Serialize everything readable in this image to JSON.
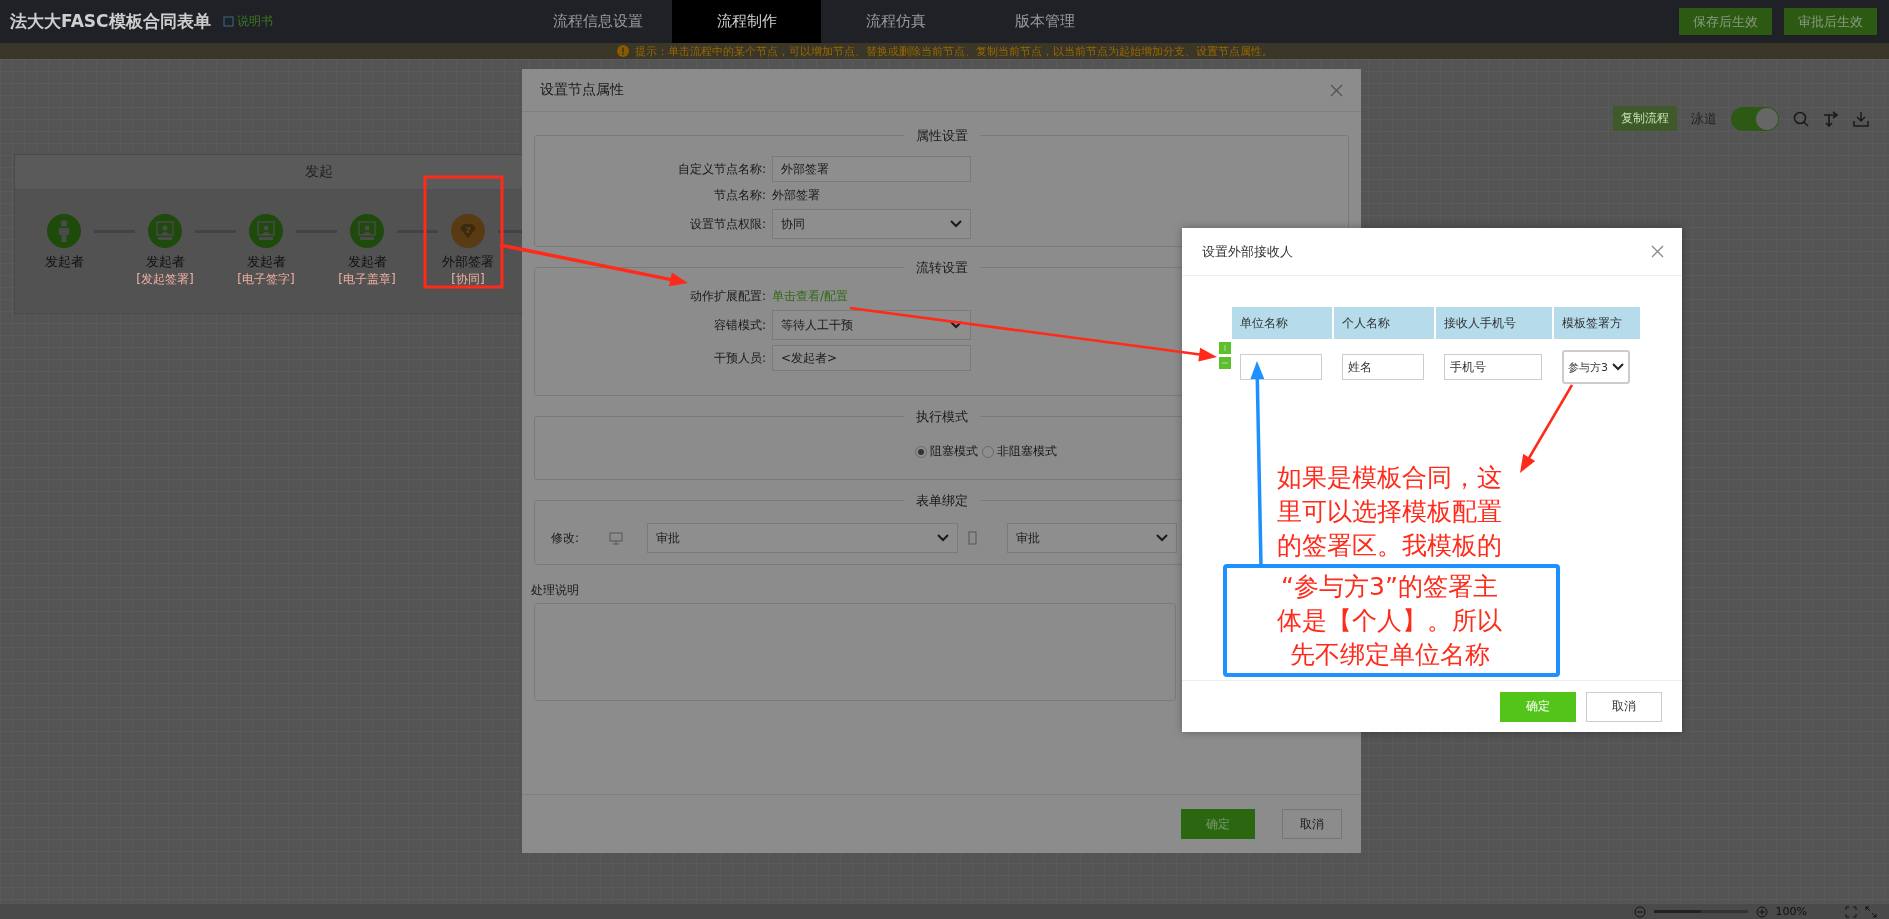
{
  "app": {
    "title": "法大大FASC模板合同表单",
    "manual_link": "说明书"
  },
  "nav_tabs": [
    {
      "label": "流程信息设置",
      "selected": false
    },
    {
      "label": "流程制作",
      "selected": true
    },
    {
      "label": "流程仿真",
      "selected": false
    },
    {
      "label": "版本管理",
      "selected": false
    }
  ],
  "header_buttons": [
    "保存后生效",
    "审批后生效"
  ],
  "hint": "提示：单击流程中的某个节点，可以增加节点、替换或删除当前节点、复制当前节点，以当前节点为起始增加分支、设置节点属性。",
  "toolbar": {
    "copy_button": "复制流程",
    "lane_label": "泳道",
    "lane_on": true
  },
  "lane": {
    "title": "发起",
    "nodes": [
      {
        "kind": "starter",
        "name": "发起者"
      },
      {
        "kind": "signer",
        "name": "发起者",
        "role": "[发起签署]"
      },
      {
        "kind": "signer",
        "name": "发起者",
        "role": "[电子签字]"
      },
      {
        "kind": "signer",
        "name": "发起者",
        "role": "[电子盖章]"
      },
      {
        "kind": "external",
        "name": "外部签署",
        "role": "[协同]"
      }
    ]
  },
  "zoom": {
    "level": 0.5,
    "reading": "100%"
  },
  "node_dialog": {
    "title": "设置节点属性",
    "sections": [
      {
        "title": "属性设置",
        "fields": [
          {
            "kind": "input",
            "label": "自定义节点名称:",
            "value": "外部签署"
          },
          {
            "kind": "text",
            "label": "节点名称:",
            "value": "外部签署"
          },
          {
            "kind": "select",
            "label": "设置节点权限:",
            "value": "协同"
          }
        ]
      },
      {
        "title": "流转设置",
        "fields": [
          {
            "kind": "link",
            "label": "动作扩展配置:",
            "value": "单击查看/配置"
          },
          {
            "kind": "select",
            "label": "容错模式:",
            "value": "等待人工干预"
          },
          {
            "kind": "input",
            "label": "干预人员:",
            "value": "<发起者>"
          }
        ]
      }
    ],
    "exec_mode": {
      "title": "执行模式",
      "options": [
        {
          "label": "阻塞模式",
          "selected": true
        },
        {
          "label": "非阻塞模式",
          "selected": false
        }
      ]
    },
    "form_binding": {
      "title": "表单绑定",
      "label": "修改:",
      "pc_form": "审批",
      "mobile_form": "审批"
    },
    "notes_label": "处理说明",
    "buttons": [
      "确定",
      "取消"
    ]
  },
  "recipient_dialog": {
    "title": "设置外部接收人",
    "columns": [
      "单位名称",
      "个人名称",
      "接收人手机号",
      "模板签署方"
    ],
    "rows": [
      {
        "cells": [
          {
            "kind": "input"
          },
          {
            "kind": "input",
            "placeholder": "姓名"
          },
          {
            "kind": "input",
            "placeholder": "手机号"
          },
          {
            "kind": "select",
            "value": "参与方3"
          }
        ]
      }
    ],
    "buttons": [
      "确定",
      "取消"
    ]
  },
  "annotation": {
    "texts": [
      "如果是模板合同，这里可以选择模板配置的签署区。我模板的",
      "“参与方3”的签署主体是【个人】。所以先不绑定单位名称"
    ]
  }
}
